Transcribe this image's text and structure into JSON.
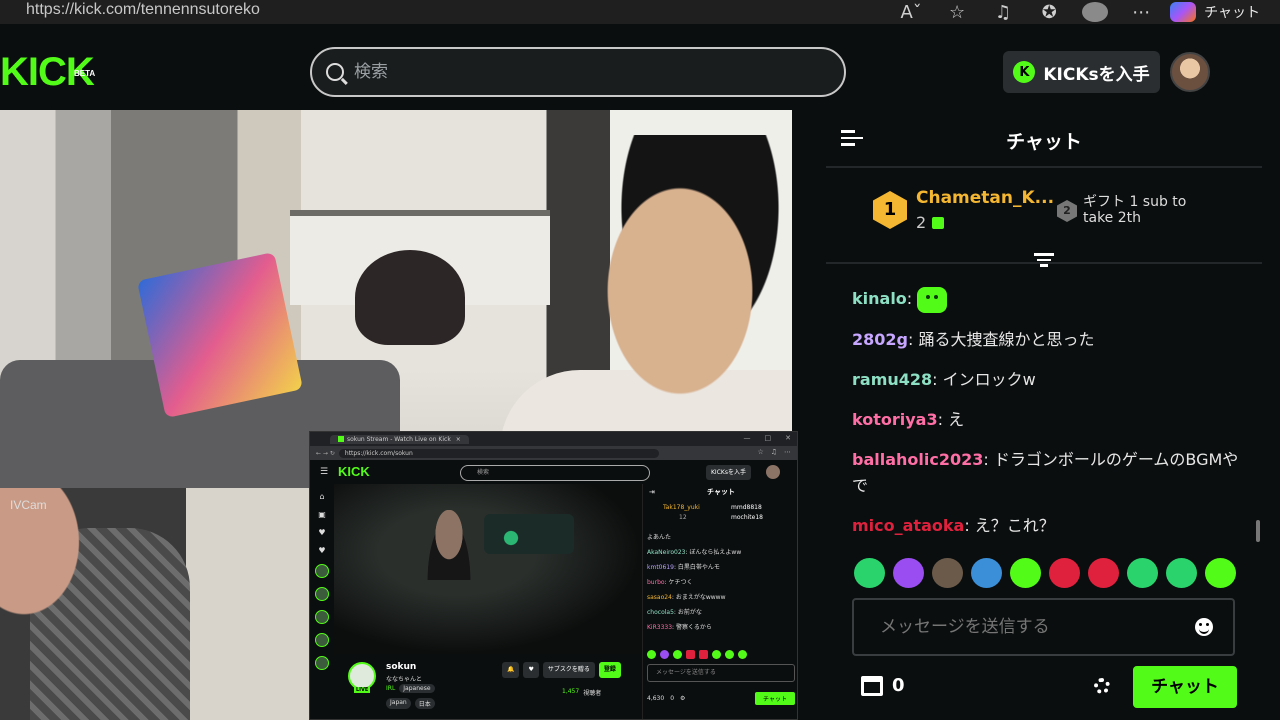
{
  "browser": {
    "url": "https://kick.com/tennennsutoreko",
    "copilot_label": "チャット",
    "icons": [
      "read-aloud-icon",
      "favorite-star-icon",
      "media-icon",
      "collections-icon",
      "profile-icon",
      "more-icon",
      "copilot-icon"
    ]
  },
  "header": {
    "logo": "KICK",
    "logo_badge": "BETA",
    "search_placeholder": "検索",
    "kicks_button": "KICKsを入手"
  },
  "stream": {
    "overlay_label": "IVCam"
  },
  "inner_window": {
    "tab_title": "sokun Stream - Watch Live on Kick",
    "url": "https://kick.com/sokun",
    "logo": "KICK",
    "search_placeholder": "検索",
    "kicks_button": "KICKsを入手",
    "channel_name": "sokun",
    "stream_title": "ななちゃんと",
    "live_badge": "LIVE",
    "category": "IRL",
    "tags": [
      "Japanese",
      "Japan",
      "日本"
    ],
    "subscribe_gift": "サブスクを贈る",
    "follow": "登録",
    "viewers": "1,457",
    "viewers_label": "視聴者",
    "chat_title": "チャット",
    "gift_top": "Tak178_yuki",
    "gift_top_count": "12",
    "gift_second": "mmd8818",
    "gift_third": "mochite18",
    "messages": [
      {
        "user": "",
        "text": "よあんた",
        "color": "#dddddd"
      },
      {
        "user": "AkaNeiro023",
        "text": "ぼんなら払えよww",
        "color": "#8ee0c4"
      },
      {
        "user": "kmt0619",
        "text": "白黒白帯やんモ",
        "color": "#b9a6ff"
      },
      {
        "user": "burbo",
        "text": "ケチつく",
        "color": "#ff6fa6"
      },
      {
        "user": "sasao24",
        "text": "おまえがなwwww",
        "color": "#f5b731"
      },
      {
        "user": "chocola5",
        "text": "お前がな",
        "color": "#8ee0c4"
      },
      {
        "user": "KiR3333",
        "text": "警察くるから",
        "color": "#ff6fa6"
      }
    ],
    "input_placeholder": "メッセージを送信する",
    "kicks_count": "4,630",
    "store_count": "0",
    "chat_button": "チャット"
  },
  "chat": {
    "title": "チャット",
    "gift_leader": {
      "rank": "1",
      "name": "Chametan_K...",
      "count": "2"
    },
    "gift_next": {
      "rank": "2",
      "text": "ギフト 1 sub to take 2th"
    },
    "messages": [
      {
        "user": "kinalo",
        "text": "",
        "color": "#8ee0c4",
        "emote": true
      },
      {
        "user": "2802g",
        "text": "踊る大捜査線かと思った",
        "color": "#c7a6ff"
      },
      {
        "user": "ramu428",
        "text": "インロックw",
        "color": "#8ee0c4"
      },
      {
        "user": "kotoriya3",
        "text": "え",
        "color": "#ff6fa6"
      },
      {
        "user": "ballaholic2023",
        "text": "ドラゴンボールのゲームのBGMやで",
        "color": "#ff6fa6"
      },
      {
        "user": "mico_ataoka",
        "text": "え？これ？",
        "color": "#e0213d"
      }
    ],
    "emote_colors": [
      "#2bd36d",
      "#9a4df0",
      "#6b5a4a",
      "#3a8fd8",
      "#53fc18",
      "#e0213d",
      "#e0213d",
      "#2bd36d",
      "#2bd36d",
      "#53fc18"
    ],
    "input_placeholder": "メッセージを送信する",
    "store_count": "0",
    "send_button": "チャット"
  }
}
